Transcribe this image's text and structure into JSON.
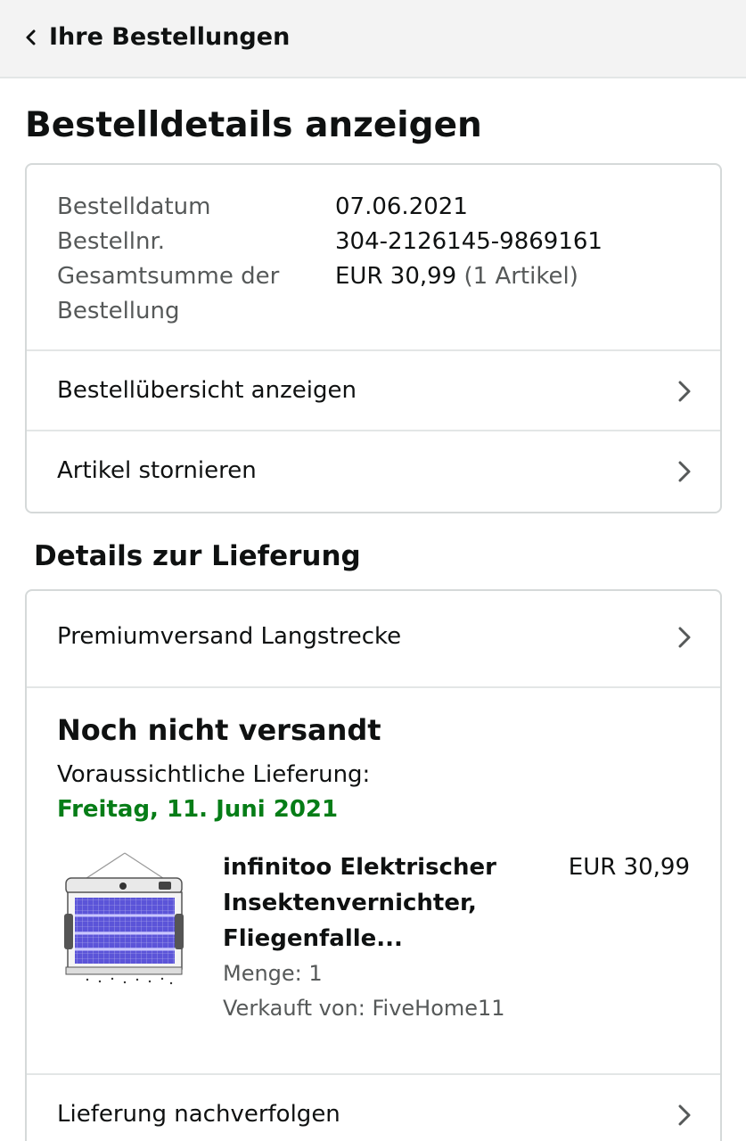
{
  "topbar": {
    "back_label": "Ihre Bestellungen"
  },
  "page_title": "Bestelldetails anzeigen",
  "summary": {
    "order_date_label": "Bestelldatum",
    "order_date_value": "07.06.2021",
    "order_number_label": "Bestellnr.",
    "order_number_value": "304-2126145-9869161",
    "total_label_line1": "Gesamtsumme der",
    "total_label_line2": "Bestellung",
    "total_value": "EUR 30,99",
    "total_items": "(1 Artikel)"
  },
  "actions": {
    "view_summary": "Bestellübersicht anzeigen",
    "cancel_items": "Artikel stornieren"
  },
  "delivery": {
    "section_title": "Details zur Lieferung",
    "shipping_method": "Premiumversand Langstrecke",
    "status": "Noch nicht versandt",
    "estimated_label": "Voraussichtliche Lieferung:",
    "estimated_date": "Freitag, 11. Juni 2021",
    "estimated_date_color": "#067d17",
    "track_label": "Lieferung nachverfolgen"
  },
  "product": {
    "title_line1": "infinitoo Elektrischer",
    "title_line2": "Insektenvernichter,",
    "title_line3": "Fliegenfalle...",
    "price": "EUR 30,99",
    "quantity": "Menge: 1",
    "seller": "Verkauft von: FiveHome11",
    "image_icon": "bug-zapper-product-image"
  }
}
